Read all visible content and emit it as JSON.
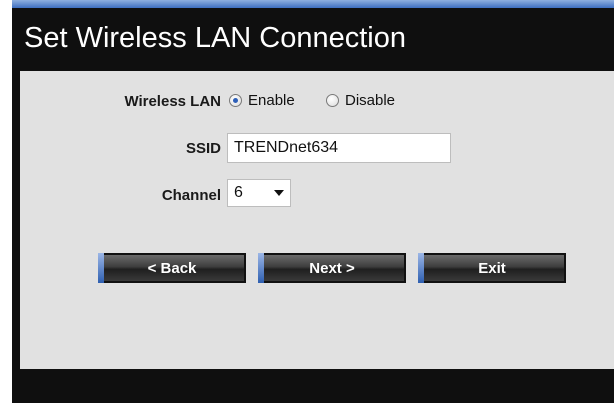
{
  "window": {
    "title": "Set Wireless LAN Connection"
  },
  "form": {
    "wireless_lan": {
      "label": "Wireless LAN",
      "options": [
        {
          "label": "Enable",
          "selected": true
        },
        {
          "label": "Disable",
          "selected": false
        }
      ]
    },
    "ssid": {
      "label": "SSID",
      "value": "TRENDnet634"
    },
    "channel": {
      "label": "Channel",
      "value": "6"
    }
  },
  "buttons": {
    "back": "< Back",
    "next": "Next >",
    "exit": "Exit"
  },
  "colors": {
    "background": "#0f0f0f",
    "panel": "#e1e1e1",
    "accent": "#3e6fc0"
  },
  "icons": {
    "radio_selected": "radio-selected-icon",
    "radio_unselected": "radio-unselected-icon",
    "dropdown": "chevron-down-icon"
  }
}
